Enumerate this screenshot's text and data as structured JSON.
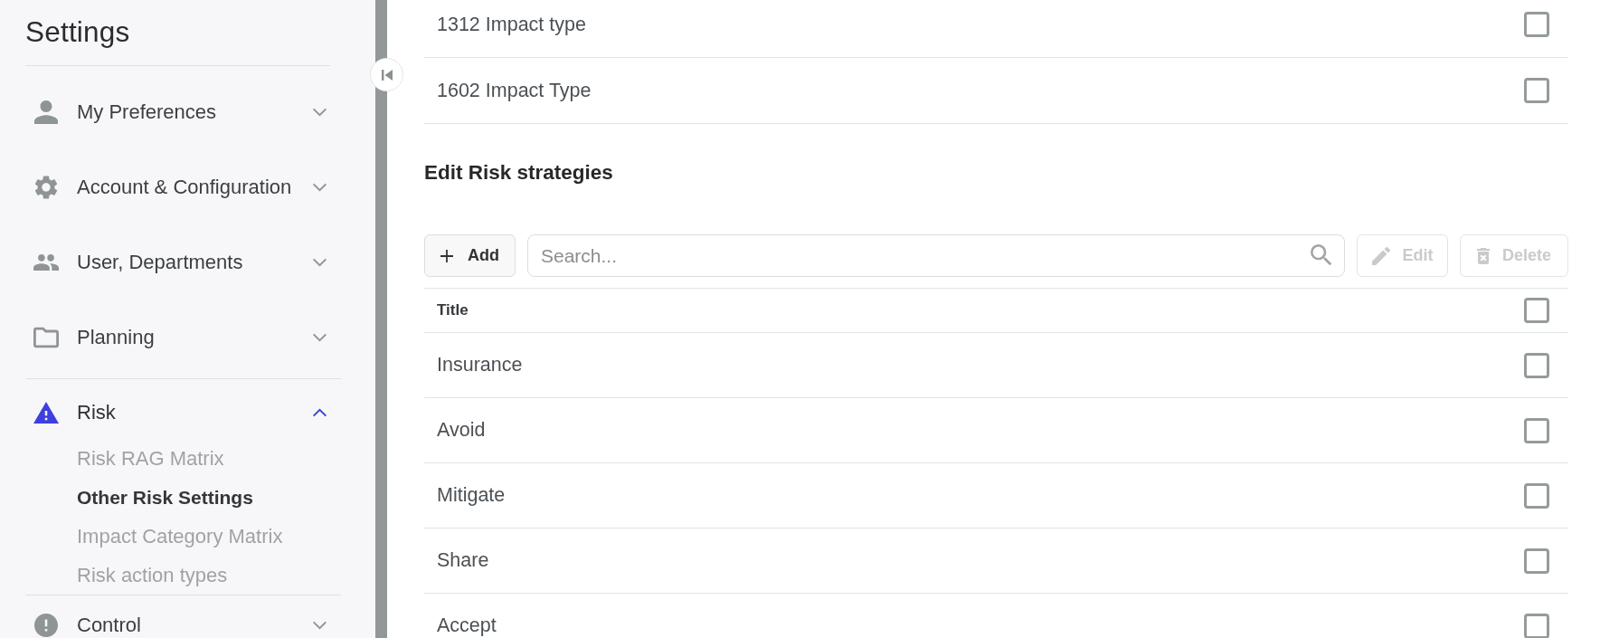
{
  "sidebar": {
    "title": "Settings",
    "sections": [
      {
        "label": "My Preferences",
        "expanded": false
      },
      {
        "label": "Account & Configuration",
        "expanded": false
      },
      {
        "label": "User, Departments",
        "expanded": false
      },
      {
        "label": "Planning",
        "expanded": false
      },
      {
        "label": "Risk",
        "expanded": true,
        "children": [
          {
            "label": "Risk RAG Matrix",
            "selected": false
          },
          {
            "label": "Other Risk Settings",
            "selected": true
          },
          {
            "label": "Impact Category Matrix",
            "selected": false
          },
          {
            "label": "Risk action types",
            "selected": false
          }
        ]
      },
      {
        "label": "Control",
        "expanded": false
      }
    ]
  },
  "impact_types": {
    "rows": [
      {
        "title": "1312 Impact type",
        "checked": false
      },
      {
        "title": "1602 Impact Type",
        "checked": false
      }
    ]
  },
  "risk_strategies": {
    "heading": "Edit Risk strategies",
    "toolbar": {
      "add_button": {
        "label": "Add",
        "disabled": false
      },
      "search": {
        "placeholder": "Search..."
      },
      "edit_button": {
        "label": "Edit",
        "disabled": true
      },
      "delete_button": {
        "label": "Delete",
        "disabled": true
      }
    },
    "table": {
      "columns": [
        {
          "title": "Title"
        }
      ],
      "all_checked": false,
      "rows": [
        {
          "title": "Insurance",
          "checked": false
        },
        {
          "title": "Avoid",
          "checked": false
        },
        {
          "title": "Mitigate",
          "checked": false
        },
        {
          "title": "Share",
          "checked": false
        },
        {
          "title": "Accept",
          "checked": false
        }
      ]
    }
  }
}
